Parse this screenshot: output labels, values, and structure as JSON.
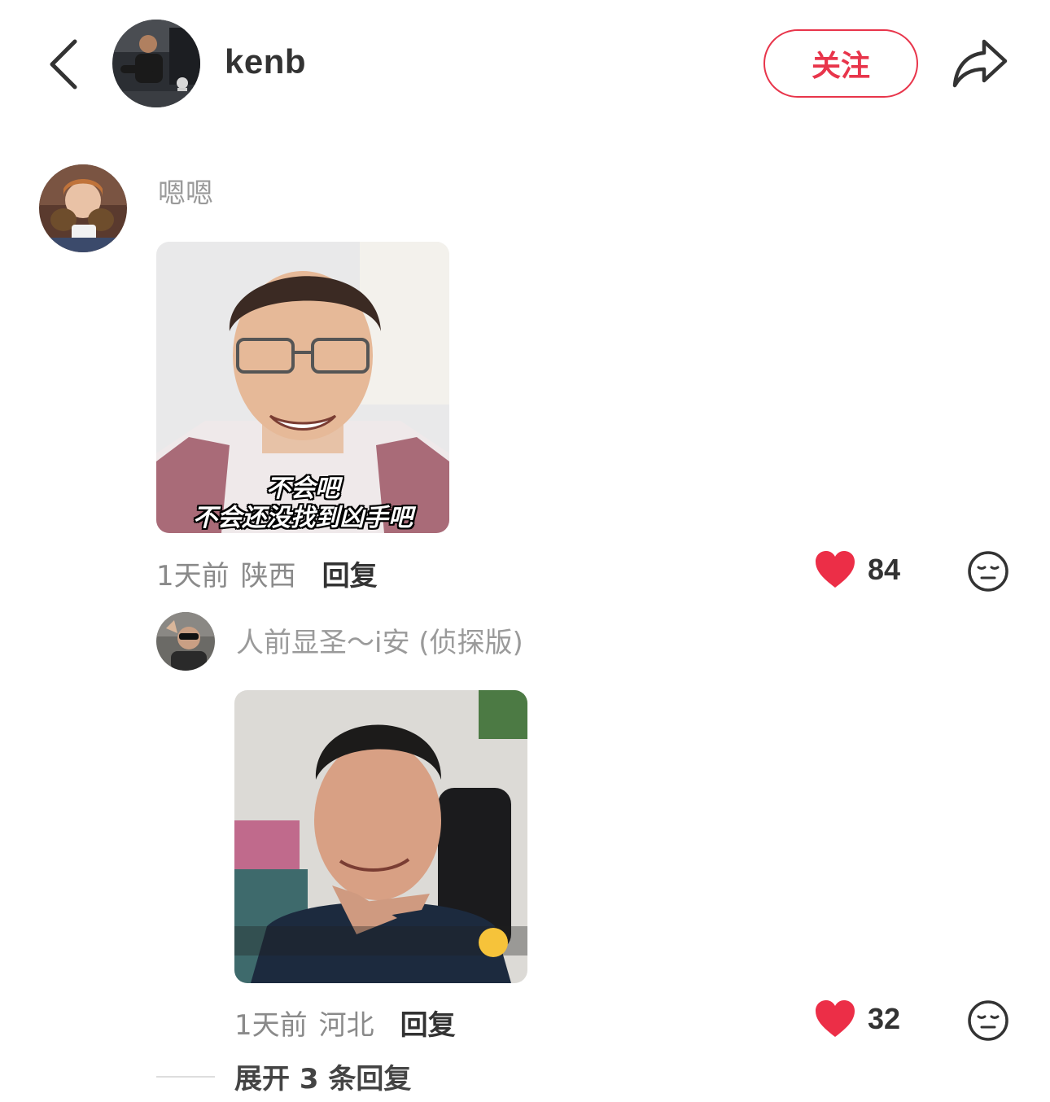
{
  "header": {
    "back_icon": "chevron-left-icon",
    "author_name": "kenb",
    "follow_label": "关注",
    "share_icon": "share-arrow-icon",
    "accent_color": "#e8354b"
  },
  "comments": [
    {
      "user": "嗯嗯",
      "image_caption_line1": "不会吧",
      "image_caption_line2": "不会还没找到凶手吧",
      "time": "1天前",
      "location": "陕西",
      "reply_label": "回复",
      "likes": "84",
      "emoji_icon": "expressionless-face-icon"
    }
  ],
  "replies": [
    {
      "user": "人前显圣～i安 (侦探版)",
      "time": "1天前",
      "location": "河北",
      "reply_label": "回复",
      "likes": "32",
      "emoji_icon": "expressionless-face-icon"
    }
  ],
  "expand_label": "展开 3 条回复"
}
